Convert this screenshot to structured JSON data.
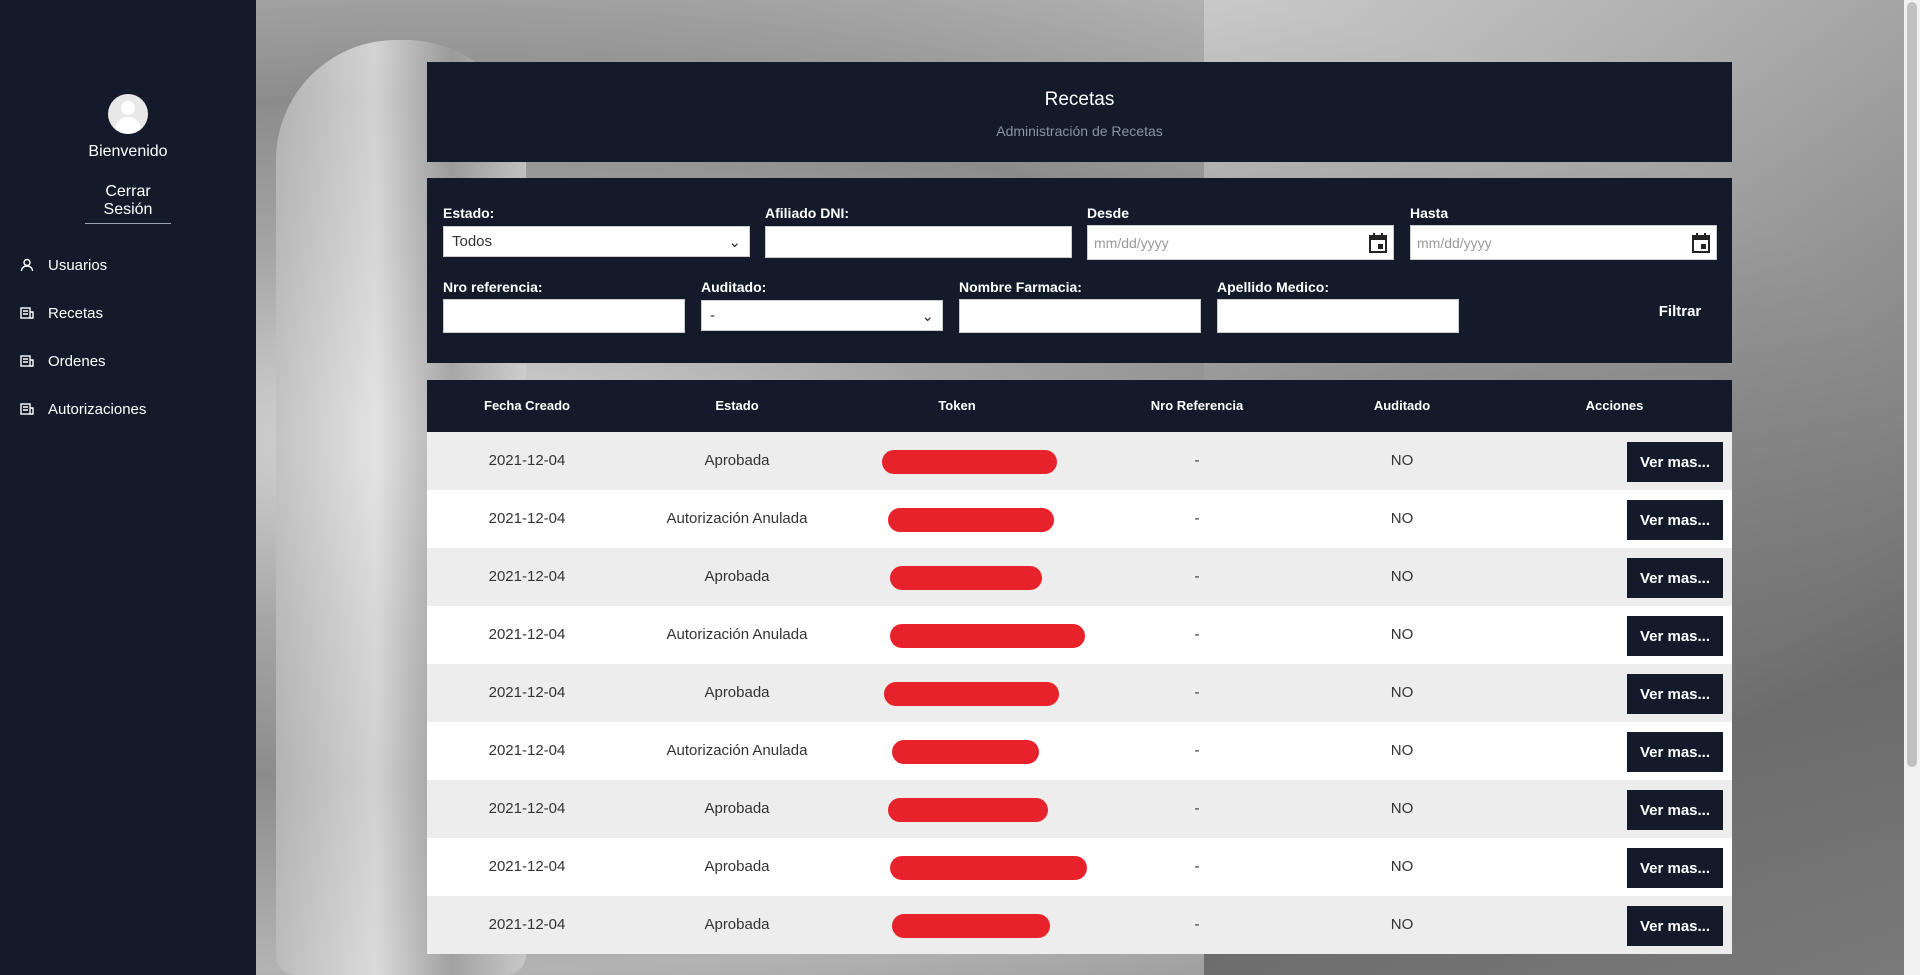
{
  "sidebar": {
    "welcome": "Bienvenido",
    "logout": "Cerrar Sesión",
    "items": [
      {
        "label": "Usuarios",
        "icon": "user-icon"
      },
      {
        "label": "Recetas",
        "icon": "receipt-icon"
      },
      {
        "label": "Ordenes",
        "icon": "receipt-icon"
      },
      {
        "label": "Autorizaciones",
        "icon": "receipt-icon"
      }
    ]
  },
  "header": {
    "title": "Recetas",
    "subtitle": "Administración de Recetas"
  },
  "filters": {
    "estado_label": "Estado:",
    "estado_value": "Todos",
    "dni_label": "Afiliado DNI:",
    "desde_label": "Desde",
    "desde_placeholder": "mm/dd/yyyy",
    "hasta_label": "Hasta",
    "hasta_placeholder": "mm/dd/yyyy",
    "nro_ref_label": "Nro referencia:",
    "auditado_label": "Auditado:",
    "auditado_value": "-",
    "farmacia_label": "Nombre Farmacia:",
    "medico_label": "Apellido Medico:",
    "filtrar": "Filtrar"
  },
  "table": {
    "columns": [
      "Fecha Creado",
      "Estado",
      "Token",
      "Nro Referencia",
      "Auditado",
      "Acciones"
    ],
    "action_label": "Ver mas...",
    "rows": [
      {
        "fecha": "2021-12-04",
        "estado": "Aprobada",
        "nro_ref": "-",
        "auditado": "NO"
      },
      {
        "fecha": "2021-12-04",
        "estado": "Autorización Anulada",
        "nro_ref": "-",
        "auditado": "NO"
      },
      {
        "fecha": "2021-12-04",
        "estado": "Aprobada",
        "nro_ref": "-",
        "auditado": "NO"
      },
      {
        "fecha": "2021-12-04",
        "estado": "Autorización Anulada",
        "nro_ref": "-",
        "auditado": "NO"
      },
      {
        "fecha": "2021-12-04",
        "estado": "Aprobada",
        "nro_ref": "-",
        "auditado": "NO"
      },
      {
        "fecha": "2021-12-04",
        "estado": "Autorización Anulada",
        "nro_ref": "-",
        "auditado": "NO"
      },
      {
        "fecha": "2021-12-04",
        "estado": "Aprobada",
        "nro_ref": "-",
        "auditado": "NO"
      },
      {
        "fecha": "2021-12-04",
        "estado": "Aprobada",
        "nro_ref": "-",
        "auditado": "NO"
      },
      {
        "fecha": "2021-12-04",
        "estado": "Aprobada",
        "nro_ref": "-",
        "auditado": "NO"
      }
    ]
  },
  "colors": {
    "navy": "#131b2b",
    "redaction": "#e8222a"
  }
}
